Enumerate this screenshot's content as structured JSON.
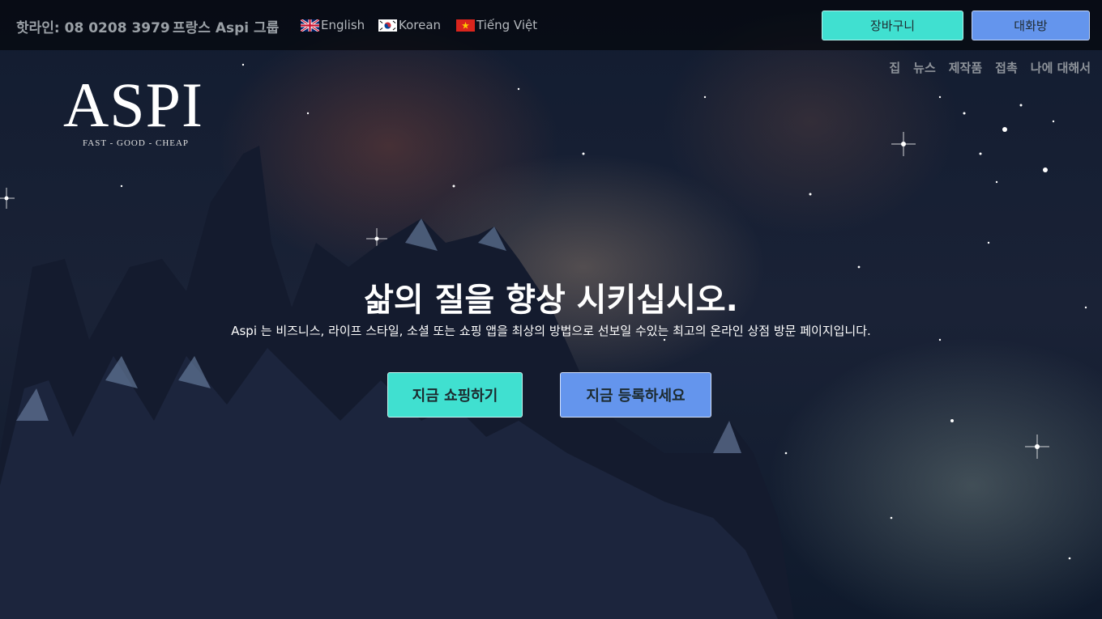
{
  "topbar": {
    "hotline": "핫라인: 08 0208 3979",
    "group": "프랑스 Aspi 그룹",
    "languages": [
      {
        "label": "English",
        "icon": "uk-flag-icon"
      },
      {
        "label": "Korean",
        "icon": "korea-flag-icon"
      },
      {
        "label": "Tiếng Việt",
        "icon": "vietnam-flag-icon"
      }
    ],
    "cart_label": "장바구니",
    "chat_label": "대화방"
  },
  "nav": {
    "items": [
      "집",
      "뉴스",
      "제작품",
      "접촉",
      "나에 대해서"
    ]
  },
  "logo": {
    "text": "ASPI",
    "tagline": "FAST - GOOD - CHEAP"
  },
  "hero": {
    "title": "삶의 질을 향상 시키십시오.",
    "subtitle": "Aspi 는 비즈니스, 라이프 스타일, 소셜 또는 쇼핑 앱을 최상의 방법으로 선보일 수있는 최고의 온라인 상점 방문 페이지입니다.",
    "shop_button": "지금 쇼핑하기",
    "register_button": "지금 등록하세요"
  },
  "colors": {
    "teal": "#40e0d0",
    "blue": "#6495ed"
  }
}
